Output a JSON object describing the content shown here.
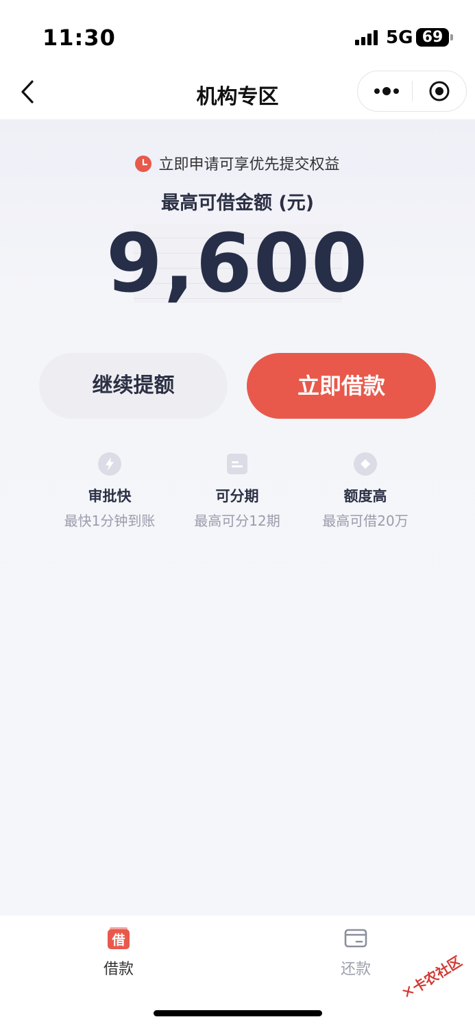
{
  "status_bar": {
    "time": "11:30",
    "network": "5G",
    "battery": "69"
  },
  "navbar": {
    "title": "机构专区",
    "back_icon": "chevron-left-icon",
    "more_icon": "more-dots-icon",
    "close_icon": "target-circle-icon"
  },
  "hero": {
    "notice": "立即申请可享优先提交权益",
    "amount_label": "最高可借金额 (元)",
    "amount": "9,600"
  },
  "actions": {
    "secondary": "继续提额",
    "primary": "立即借款"
  },
  "features": [
    {
      "icon": "lightning-icon",
      "title": "审批快",
      "subtitle": "最快1分钟到账"
    },
    {
      "icon": "document-icon",
      "title": "可分期",
      "subtitle": "最高可分12期"
    },
    {
      "icon": "diamond-icon",
      "title": "额度高",
      "subtitle": "最高可借20万"
    }
  ],
  "tabs": [
    {
      "label": "借款",
      "icon_text": "借",
      "active": true
    },
    {
      "label": "还款",
      "icon": "card-icon",
      "active": false
    }
  ],
  "watermark": "卡农社区",
  "colors": {
    "accent": "#e8594c",
    "text_dark": "#272e48",
    "muted": "#9a9cab"
  }
}
